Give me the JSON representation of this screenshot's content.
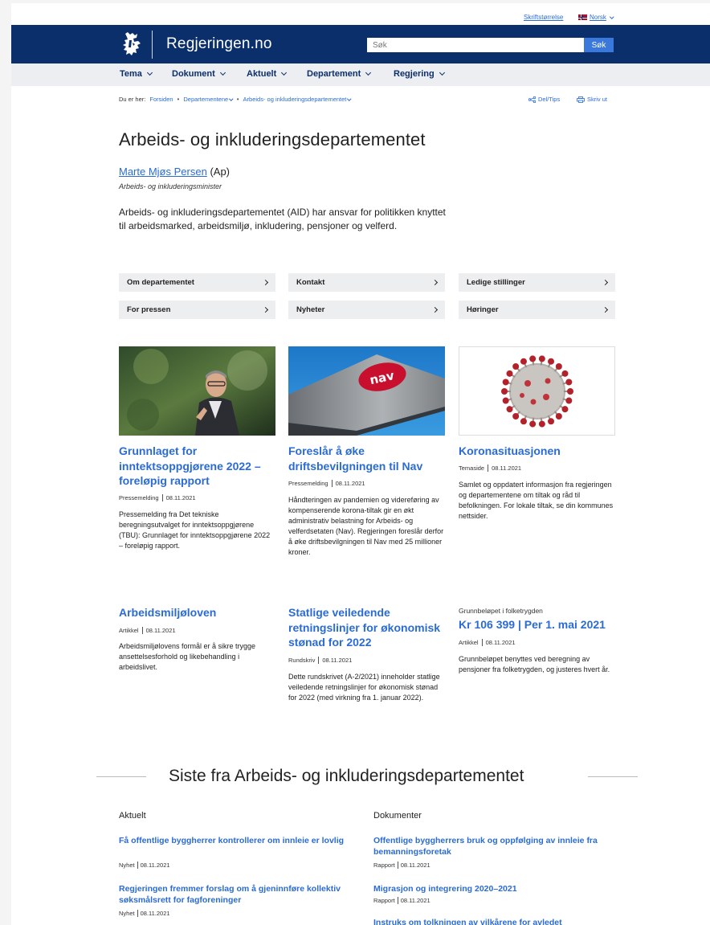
{
  "utility": {
    "font_size": "Skriftstørrelse",
    "language": "Norsk"
  },
  "header": {
    "site_title": "Regjeringen.no",
    "search_placeholder": "Søk",
    "search_button": "Søk"
  },
  "nav": {
    "items": [
      "Tema",
      "Dokument",
      "Aktuelt",
      "Departement",
      "Regjering"
    ]
  },
  "breadcrumb": {
    "prefix": "Du er her:",
    "items": [
      "Forsiden",
      "Departementene",
      "Arbeids- og inkluderingsdepartementet"
    ],
    "share": "Del/Tips",
    "print": "Skriv ut"
  },
  "page": {
    "title": "Arbeids- og inkluderingsdepartementet",
    "minister_name": "Marte Mjøs Persen",
    "minister_party": "(Ap)",
    "minister_role": "Arbeids- og inkluderingsminister",
    "lead": "Arbeids- og inkluderingsdepartementet (AID) har ansvar for politikken knyttet til arbeidsmarked, arbeidsmiljø, inkludering, pensjoner og velferd."
  },
  "quick_links": [
    "Om departementet",
    "Kontakt",
    "Ledige stillinger",
    "For pressen",
    "Nyheter",
    "Høringer"
  ],
  "cards": [
    {
      "title": "Grunnlaget for inntektsoppgjørene 2022 – foreløpig rapport",
      "type": "Pressemelding",
      "date": "08.11.2021",
      "text": "Pressemelding fra Det tekniske beregningsutvalget for inntektsoppgjørene (TBU): Grunnlaget for inntektsoppgjørene 2022 – foreløpig rapport."
    },
    {
      "title": "Foreslår å øke driftsbevilgningen til Nav",
      "type": "Pressemelding",
      "date": "08.11.2021",
      "text": "Håndteringen av pandemien og videreføring av kompenserende korona-tiltak gir en økt administrativ belastning for Arbeids- og velferdsetaten (Nav). Regjeringen foreslår derfor å øke driftsbevilgningen til Nav med 25 millioner kroner."
    },
    {
      "title": "Koronasituasjonen",
      "type": "Temaside",
      "date": "08.11.2021",
      "text": "Samlet og oppdatert informasjon fra regjeringen og departementene om tiltak og råd til befolkningen. For lokale tiltak, se din kommunes nettsider."
    },
    {
      "title": "Arbeidsmiljøloven",
      "type": "Artikkel",
      "date": "08.11.2021",
      "text": "Arbeidsmiljølovens formål er å sikre trygge ansettelsesforhold og likebehandling i arbeidslivet."
    },
    {
      "title": "Statlige veiledende retningslinjer for økonomisk stønad for 2022",
      "type": "Rundskriv",
      "date": "08.11.2021",
      "text": "Dette rundskrivet (A-2/2021) inneholder statlige veiledende retningslinjer for økonomisk stønad for 2022 (med virkning fra 1. januar 2022)."
    },
    {
      "kicker": "Grunnbeløpet i folketrygden",
      "title": "Kr 106 399 | Per 1. mai 2021",
      "type": "Artikkel",
      "date": "08.11.2021",
      "text": "Grunnbeløpet benyttes ved beregning av pensjoner fra folketrygden, og justeres hvert år."
    }
  ],
  "nav_logo": {
    "brand_color": "#0b2f6b"
  },
  "nav_logo_img": "nav",
  "latest": {
    "title": "Siste fra Arbeids- og inkluderingsdepartementet",
    "aktuelt_head": "Aktuelt",
    "dokumenter_head": "Dokumenter",
    "aktuelt": [
      {
        "title": "Få offentlige byggherrer kontrollerer om innleie er lovlig",
        "type": "Nyhet",
        "date": "08.11.2021"
      },
      {
        "title": "Regjeringen fremmer forslag om å gjeninnføre kollektiv søksmålsrett for fagforeninger",
        "type": "Nyhet",
        "date": "08.11.2021"
      }
    ],
    "dokumenter": [
      {
        "title": "Offentlige byggherrers bruk og oppfølging av innleie fra bemanningsforetak",
        "type": "Rapport",
        "date": "08.11.2021"
      },
      {
        "title": "Migrasjon og integrering 2020–2021",
        "type": "Rapport",
        "date": "08.11.2021"
      },
      {
        "title": "Instruks om tolkningen av vilkårene for avledet",
        "type": "",
        "date": ""
      }
    ]
  },
  "colors": {
    "header_bg": "#0b2f6b",
    "link": "#2a6bd6",
    "nav_bg": "#eceef1",
    "quicklink_bg": "#edeef0"
  }
}
